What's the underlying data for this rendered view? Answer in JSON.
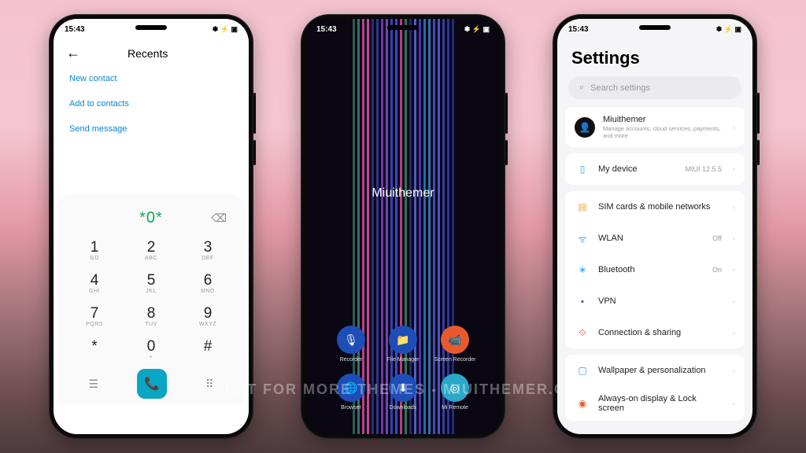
{
  "status": {
    "time": "15:43",
    "icons": "✽ ⚡ ▣"
  },
  "watermark": "VISIT FOR MORE THEMES - MIUITHEMER.COM",
  "phone1": {
    "header": "Recents",
    "links": {
      "new": "New contact",
      "add": "Add to contacts",
      "send": "Send message"
    },
    "dialed": "*0*",
    "keys": [
      {
        "d": "1",
        "l": "GD"
      },
      {
        "d": "2",
        "l": "ABC"
      },
      {
        "d": "3",
        "l": "DEF"
      },
      {
        "d": "4",
        "l": "GHI"
      },
      {
        "d": "5",
        "l": "JKL"
      },
      {
        "d": "6",
        "l": "MNO"
      },
      {
        "d": "7",
        "l": "PQRS"
      },
      {
        "d": "8",
        "l": "TUV"
      },
      {
        "d": "9",
        "l": "WXYZ"
      },
      {
        "d": "*",
        "l": ""
      },
      {
        "d": "0",
        "l": "+"
      },
      {
        "d": "#",
        "l": ""
      }
    ]
  },
  "phone2": {
    "brand": "Miuithemer",
    "stripeColors": [
      "#2e6b5f",
      "#3a8670",
      "#d94aa6",
      "#e055b0",
      "#2a3590",
      "#3340a8",
      "#7a3fc9",
      "#8a4bdb",
      "#3a4fd4",
      "#4258e0",
      "#d44a98",
      "#2f8a6e",
      "#24356a",
      "#5a6cf0",
      "#4a3fd0",
      "#2d7abf",
      "#3486cc",
      "#4c58d6",
      "#5862e0",
      "#3a48c8",
      "#2f40b0",
      "#24358e"
    ],
    "apps": [
      {
        "label": "Recorder",
        "glyph": "🎙",
        "cls": ""
      },
      {
        "label": "File Manager",
        "glyph": "📁",
        "cls": ""
      },
      {
        "label": "Screen Recorder",
        "glyph": "📹",
        "cls": "orange"
      },
      {
        "label": "Browser",
        "glyph": "🌐",
        "cls": ""
      },
      {
        "label": "Downloads",
        "glyph": "⬇",
        "cls": ""
      },
      {
        "label": "Mi Remote",
        "glyph": "◎",
        "cls": "cyan"
      }
    ]
  },
  "phone3": {
    "title": "Settings",
    "searchPlaceholder": "Search settings",
    "account": {
      "name": "Miuithemer",
      "sub": "Manage accounts, cloud services, payments, and more"
    },
    "device": {
      "label": "My device",
      "value": "MIUI 12.5.5"
    },
    "rows": [
      {
        "icon": "▤",
        "color": "#f5a623",
        "label": "SIM cards & mobile networks",
        "value": ""
      },
      {
        "icon": "ᯤ",
        "color": "#2a9df4",
        "label": "WLAN",
        "value": "Off"
      },
      {
        "icon": "∗",
        "color": "#2a9df4",
        "label": "Bluetooth",
        "value": "On"
      },
      {
        "icon": "▪",
        "color": "#5b4fd6",
        "label": "VPN",
        "value": ""
      },
      {
        "icon": "⟐",
        "color": "#e85a2c",
        "label": "Connection & sharing",
        "value": ""
      }
    ],
    "rows2": [
      {
        "icon": "▢",
        "color": "#2a9df4",
        "label": "Wallpaper & personalization",
        "value": ""
      },
      {
        "icon": "◉",
        "color": "#e85a2c",
        "label": "Always-on display & Lock screen",
        "value": ""
      }
    ]
  }
}
